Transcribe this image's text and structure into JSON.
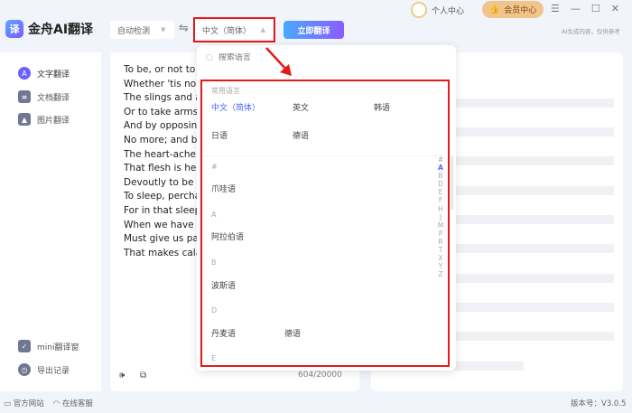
{
  "app": {
    "title": "金舟AI翻译",
    "logo_glyph": "译"
  },
  "header": {
    "user_center": "个人中心",
    "vip_center": "会员中心",
    "ai_notice": "AI生成内容，仅供参考",
    "window_controls": [
      "menu",
      "minimize",
      "maximize",
      "close"
    ]
  },
  "sidebar": {
    "items": [
      {
        "label": "文字翻译",
        "active": true
      },
      {
        "label": "文档翻译"
      },
      {
        "label": "图片翻译"
      }
    ],
    "bottom": [
      {
        "label": "mini翻译窗"
      },
      {
        "label": "导出记录"
      }
    ]
  },
  "toolbar": {
    "source_lang": "自动检测",
    "target_lang": "中文（简体）",
    "translate_button": "立即翻译"
  },
  "source": {
    "lines": [
      "To be, or not to be",
      "Whether 'tis nobler",
      "The slings and arrows",
      "Or to take arms against",
      "And by opposing",
      "No more; and by",
      "The heart-ache and",
      "That flesh is heir",
      "Devoutly to be wished",
      "To sleep, perchance",
      "For in that sleep",
      "When we have shuffled",
      "Must give us pause",
      "That makes calamity"
    ],
    "char_count": "604/20000"
  },
  "dropdown": {
    "search_placeholder": "搜索语言",
    "common_title": "常用语言",
    "common": [
      "中文（简体）",
      "英文",
      "韩语",
      "日语",
      "德语"
    ],
    "groups": [
      {
        "letter": "#",
        "items": [
          "爪哇语"
        ]
      },
      {
        "letter": "A",
        "items": [
          "阿拉伯语"
        ]
      },
      {
        "letter": "B",
        "items": [
          "波斯语"
        ]
      },
      {
        "letter": "D",
        "items": [
          "丹麦语",
          "德语"
        ]
      },
      {
        "letter": "E",
        "items": []
      }
    ],
    "index": [
      "#",
      "A",
      "B",
      "D",
      "E",
      "F",
      "H",
      "J",
      "M",
      "P",
      "R",
      "T",
      "X",
      "Y",
      "Z"
    ],
    "active_index": "A"
  },
  "footer": {
    "website": "官方网站",
    "support": "在线客服",
    "version": "版本号：V3.0.5"
  },
  "colors": {
    "accent": "#4a63ff",
    "highlight": "#e21a1a",
    "vip": "#f0c48a"
  }
}
